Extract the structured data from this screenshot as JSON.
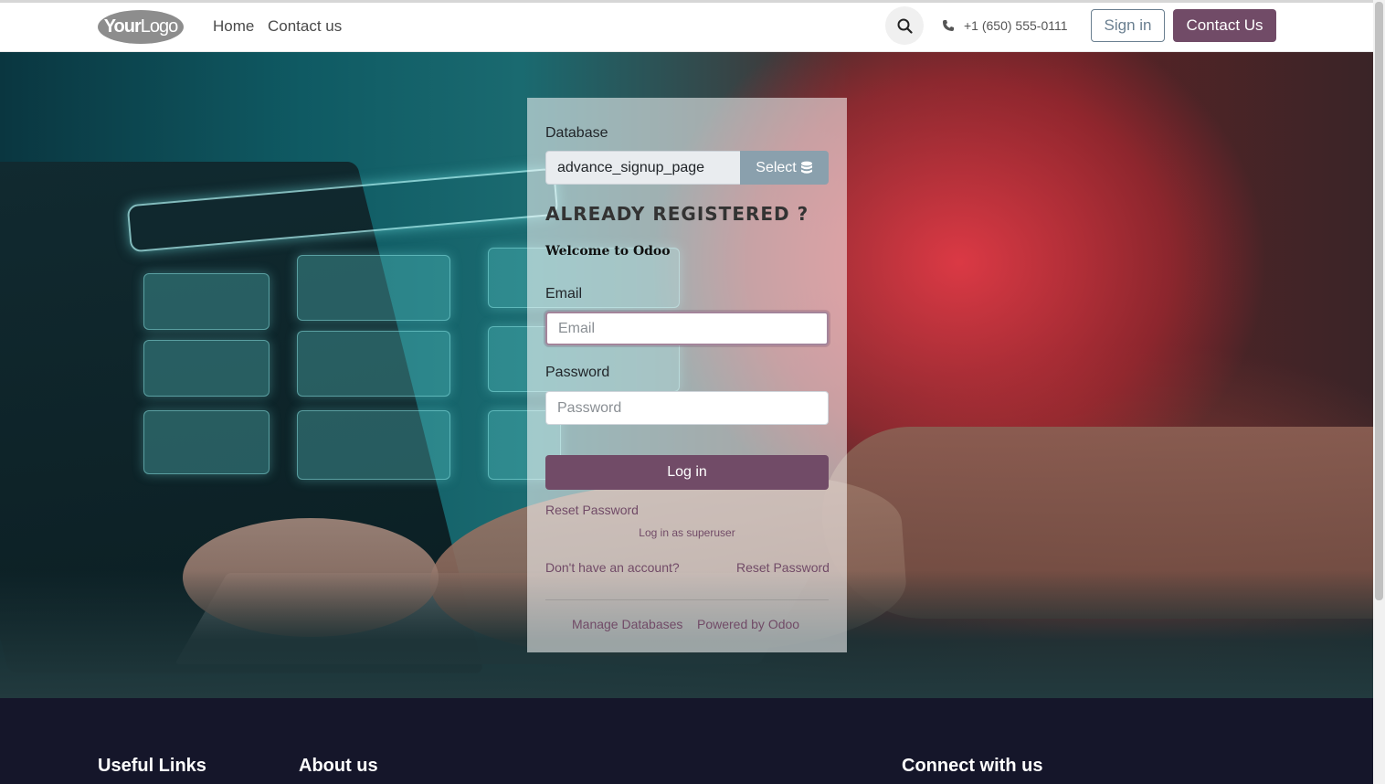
{
  "header": {
    "logo_text_bold": "Your",
    "logo_text": "Logo",
    "nav": [
      "Home",
      "Contact us"
    ],
    "phone": "+1 (650) 555-0111",
    "signin_label": "Sign in",
    "contact_label": "Contact Us"
  },
  "login": {
    "database_label": "Database",
    "database_value": "advance_signup_page",
    "select_label": "Select",
    "title": "ALREADY REGISTERED ?",
    "welcome": "Welcome to Odoo",
    "email_label": "Email",
    "email_placeholder": "Email",
    "password_label": "Password",
    "password_placeholder": "Password",
    "login_button": "Log in",
    "reset_password": "Reset Password",
    "superuser": "Log in as superuser",
    "no_account": "Don't have an account?",
    "reset_password_2": "Reset Password",
    "manage_databases": "Manage Databases",
    "powered_by": "Powered by Odoo"
  },
  "footer": {
    "headings": [
      "Useful Links",
      "About us",
      "Connect with us"
    ]
  },
  "colors": {
    "brand": "#714b67",
    "footer_bg": "#15162a",
    "secondary": "#8aa0ad"
  }
}
